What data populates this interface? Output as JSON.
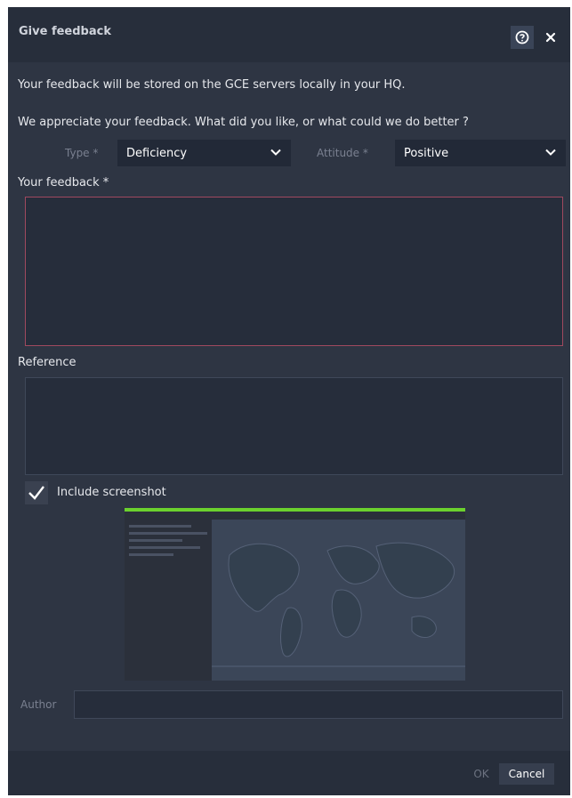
{
  "dialog": {
    "title": "Give feedback",
    "help_icon": "help-circle-icon",
    "close_icon": "close-icon"
  },
  "info": {
    "storage_notice": "Your feedback will be stored on the GCE servers locally in your HQ.",
    "prompt": "We appreciate your feedback. What did you like, or what could we do better ?"
  },
  "form": {
    "type_label": "Type *",
    "type_value": "Deficiency",
    "attitude_label": "Attitude *",
    "attitude_value": "Positive",
    "feedback_label": "Your feedback *",
    "feedback_value": "",
    "reference_label": "Reference",
    "reference_value": "",
    "include_screenshot_label": "Include screenshot",
    "include_screenshot_checked": true,
    "author_label": "Author",
    "author_value": ""
  },
  "footer": {
    "ok_label": "OK",
    "cancel_label": "Cancel"
  },
  "colors": {
    "dialog_bg": "#2e3543",
    "header_bg": "#272e3b",
    "invalid_border": "#a0495f",
    "screenshot_accent": "#6bd12e"
  }
}
